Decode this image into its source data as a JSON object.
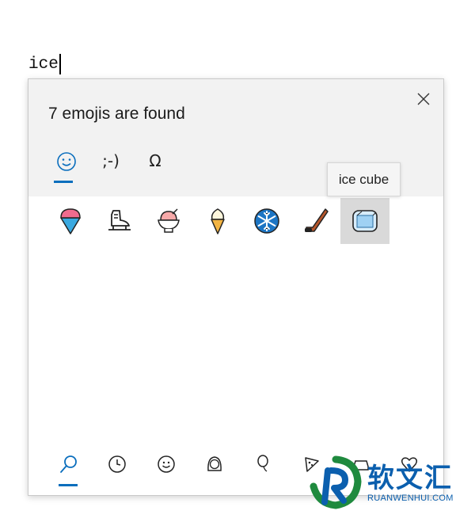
{
  "editor": {
    "typed_text": "ice"
  },
  "panel": {
    "found_text": "7 emojis are found",
    "tabs": [
      {
        "name": "emoji",
        "label": "☺",
        "active": true
      },
      {
        "name": "kaomoji",
        "label": ";-)",
        "active": false
      },
      {
        "name": "symbols",
        "label": "Ω",
        "active": false
      }
    ],
    "tooltip": "ice cube",
    "emojis": [
      {
        "name": "shaved-ice-icon"
      },
      {
        "name": "ice-skate-icon"
      },
      {
        "name": "shaved-ice-bowl-icon"
      },
      {
        "name": "soft-ice-cream-icon"
      },
      {
        "name": "snowflake-icon"
      },
      {
        "name": "ice-hockey-icon"
      },
      {
        "name": "ice-cube-icon",
        "hovered": true
      }
    ],
    "bottom_nav": [
      {
        "name": "search-icon",
        "active": true
      },
      {
        "name": "recent-clock-icon"
      },
      {
        "name": "smiley-face-icon"
      },
      {
        "name": "person-icon"
      },
      {
        "name": "balloon-icon"
      },
      {
        "name": "pizza-icon"
      },
      {
        "name": "car-icon"
      },
      {
        "name": "heart-icon"
      }
    ]
  },
  "watermark": {
    "cn": "软文汇",
    "en": "RUANWENHUI.COM"
  },
  "colors": {
    "accent": "#0a6ebd",
    "header_bg": "#f2f2f2",
    "hover_bg": "#d9d9d9"
  }
}
